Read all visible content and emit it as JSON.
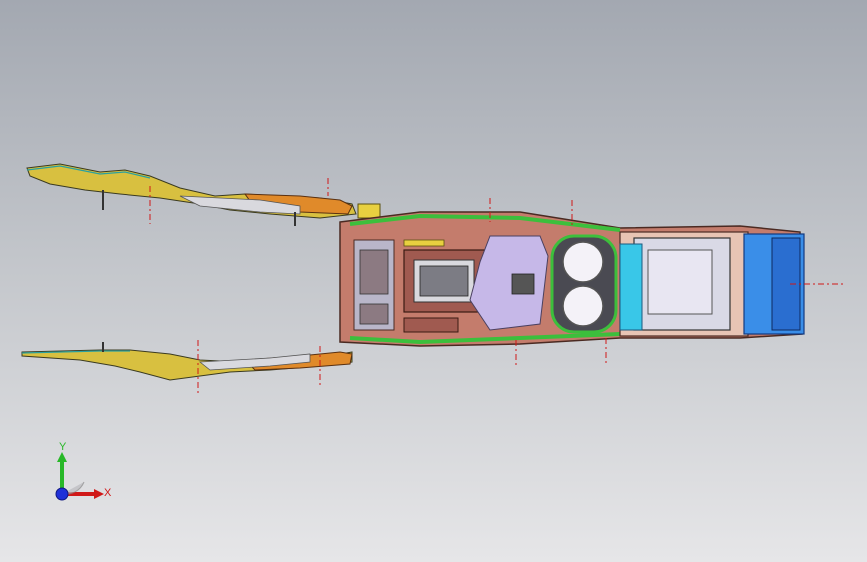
{
  "viewport": {
    "background_top": "#a3a8b1",
    "background_bottom": "#e6e6e8"
  },
  "model": {
    "part_colors": {
      "console_body": "#c47c6c",
      "console_outline": "#4a2a22",
      "green_trim": "#3cbf3c",
      "lilac_inserts": "#c6b8e8",
      "cupholder_rim": "#e8e4f0",
      "armrest_blue": "#3a8ee8",
      "cyan_panel": "#39c7e8",
      "yellow_arms": "#d8c040",
      "orange_parts": "#e08a2a",
      "centerline": "#d01818"
    }
  },
  "triad": {
    "x_label": "X",
    "y_label": "Y",
    "x_color": "#d01818",
    "y_color": "#28b828",
    "z_color": "#2030d8"
  }
}
